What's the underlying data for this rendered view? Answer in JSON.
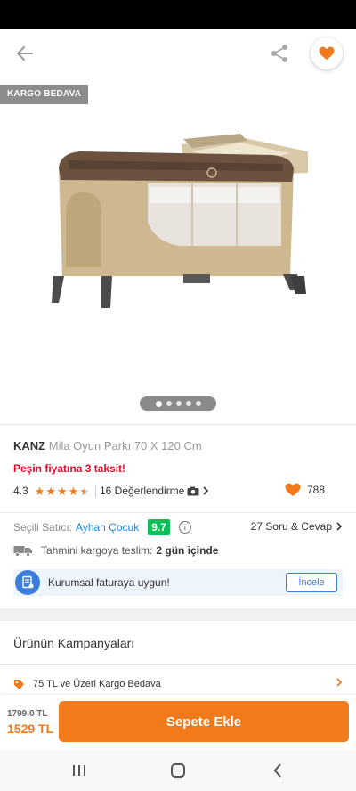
{
  "header": {
    "back_icon": "arrow-left-icon",
    "share_icon": "share-icon",
    "favorite_icon": "heart-icon"
  },
  "gallery": {
    "badge": "KARGO BEDAVA",
    "image_count": 5,
    "active_index": 0
  },
  "product": {
    "brand": "KANZ",
    "name": "Mila Oyun Parkı 70 X 120 Cm",
    "installment_text": "Peşin fiyatına 3 taksit!",
    "rating": "4.3",
    "rating_value": 4.3,
    "reviews_text": "16 Değerlendirme",
    "favorite_count": "788"
  },
  "seller": {
    "label": "Seçili Satıcı:",
    "name": "Ayhan Çocuk",
    "score": "9.7",
    "qa_text": "27 Soru & Cevap"
  },
  "delivery": {
    "label": "Tahmini kargoya teslim:",
    "value": "2 gün içinde"
  },
  "invoice": {
    "text": "Kurumsal faturaya uygun!",
    "button": "İncele"
  },
  "campaigns": {
    "title": "Ürünün Kampanyaları",
    "items": [
      {
        "label": "75 TL ve Üzeri Kargo Bedava"
      }
    ]
  },
  "cart": {
    "old_price": "1799.0 TL",
    "price": "1529 TL",
    "button": "Sepete Ekle"
  },
  "colors": {
    "accent": "#f27a1a",
    "red": "#e0102a",
    "link": "#1e88e5",
    "score": "#0bbf5a",
    "info_blue": "#3d7edd"
  }
}
